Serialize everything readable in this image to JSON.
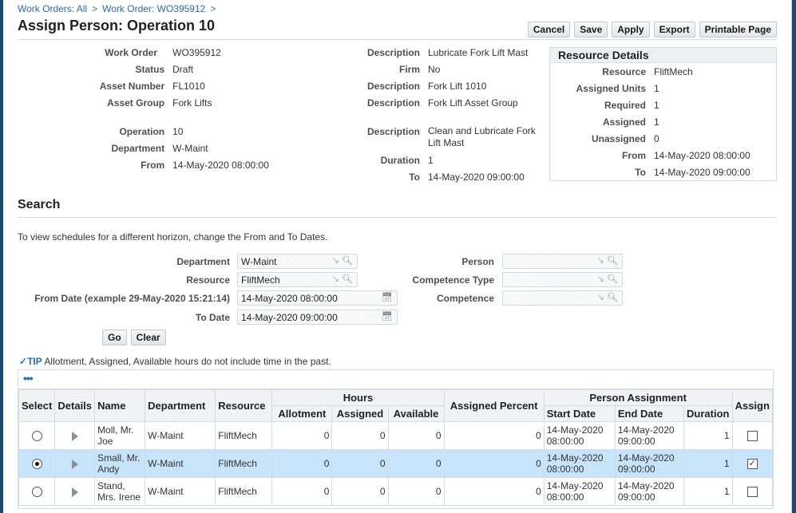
{
  "breadcrumb": [
    {
      "label": "Work Orders: All"
    },
    {
      "label": "Work Order: WO395912"
    }
  ],
  "breadcrumb_separator": ">",
  "page_title": "Assign Person: Operation 10",
  "toolbar": {
    "cancel_label": "Cancel",
    "save_label": "Save",
    "apply_label": "Apply",
    "export_label": "Export",
    "printable_label": "Printable Page"
  },
  "header_left": [
    {
      "label": "Work Order",
      "value": "WO395912"
    },
    {
      "label": "Status",
      "value": "Draft"
    },
    {
      "label": "Asset Number",
      "value": "FL1010"
    },
    {
      "label": "Asset Group",
      "value": "Fork Lifts"
    },
    {
      "label": "Operation",
      "value": "10"
    },
    {
      "label": "Department",
      "value": "W-Maint"
    },
    {
      "label": "From",
      "value": "14-May-2020 08:00:00"
    }
  ],
  "header_mid": [
    {
      "label": "Description",
      "value": "Lubricate Fork Lift Mast"
    },
    {
      "label": "Firm",
      "value": "No"
    },
    {
      "label": "Description",
      "value": "Fork Lift 1010"
    },
    {
      "label": "Description",
      "value": "Fork Lift Asset Group"
    },
    {
      "label": "Description",
      "value": "Clean and Lubricate Fork Lift Mast"
    },
    {
      "label": "Duration",
      "value": "1"
    },
    {
      "label": "To",
      "value": "14-May-2020 09:00:00"
    }
  ],
  "resource_details": {
    "title": "Resource Details",
    "rows": [
      {
        "label": "Resource",
        "value": "FliftMech"
      },
      {
        "label": "Assigned Units",
        "value": "1"
      },
      {
        "label": "Required",
        "value": "1"
      },
      {
        "label": "Assigned",
        "value": "1"
      },
      {
        "label": "Unassigned",
        "value": "0"
      },
      {
        "label": "From",
        "value": "14-May-2020 08:00:00"
      },
      {
        "label": "To",
        "value": "14-May-2020 09:00:00"
      }
    ]
  },
  "search": {
    "title": "Search",
    "hint": "To view schedules for a different horizon, change the From and To Dates.",
    "department_label": "Department",
    "department_value": "W-Maint",
    "resource_label": "Resource",
    "resource_value": "FliftMech",
    "from_date_label": "From Date (example 29-May-2020 15:21:14)",
    "from_date_value": "14-May-2020 08:00:00",
    "to_date_label": "To Date",
    "to_date_value": "14-May-2020 09:00:00",
    "person_label": "Person",
    "person_value": "",
    "competence_type_label": "Competence Type",
    "competence_type_value": "",
    "competence_label": "Competence",
    "competence_value": "",
    "go_label": "Go",
    "clear_label": "Clear"
  },
  "tip": {
    "icon": "check-circle-icon",
    "word": "TIP",
    "text": "Allotment, Assigned, Available hours do not include time in the past."
  },
  "table": {
    "more_label": "•••",
    "headers": {
      "select": "Select",
      "details": "Details",
      "name": "Name",
      "department": "Department",
      "resource": "Resource",
      "hours": "Hours",
      "allotment": "Allotment",
      "assigned": "Assigned",
      "available": "Available",
      "assigned_percent": "Assigned Percent",
      "person_assignment": "Person Assignment",
      "start_date": "Start Date",
      "end_date": "End Date",
      "duration": "Duration",
      "assign": "Assign"
    },
    "rows": [
      {
        "selected": false,
        "name": "Moll, Mr. Joe",
        "department": "W-Maint",
        "resource": "FliftMech",
        "allotment": "0",
        "assigned": "0",
        "available": "0",
        "assigned_percent": "0",
        "start_date": "14-May-2020 08:00:00",
        "end_date": "14-May-2020 09:00:00",
        "duration": "1",
        "assign": false
      },
      {
        "selected": true,
        "name": "Small, Mr. Andy",
        "department": "W-Maint",
        "resource": "FliftMech",
        "allotment": "0",
        "assigned": "0",
        "available": "0",
        "assigned_percent": "0",
        "start_date": "14-May-2020 08:00:00",
        "end_date": "14-May-2020 09:00:00",
        "duration": "1",
        "assign": true
      },
      {
        "selected": false,
        "name": "Stand, Mrs. Irene",
        "department": "W-Maint",
        "resource": "FliftMech",
        "allotment": "0",
        "assigned": "0",
        "available": "0",
        "assigned_percent": "0",
        "start_date": "14-May-2020 08:00:00",
        "end_date": "14-May-2020 09:00:00",
        "duration": "1",
        "assign": false
      }
    ]
  },
  "colors": {
    "link": "#2b6ba8",
    "selected_row": "#c8e4fb",
    "frame": "#1c4a6e"
  }
}
